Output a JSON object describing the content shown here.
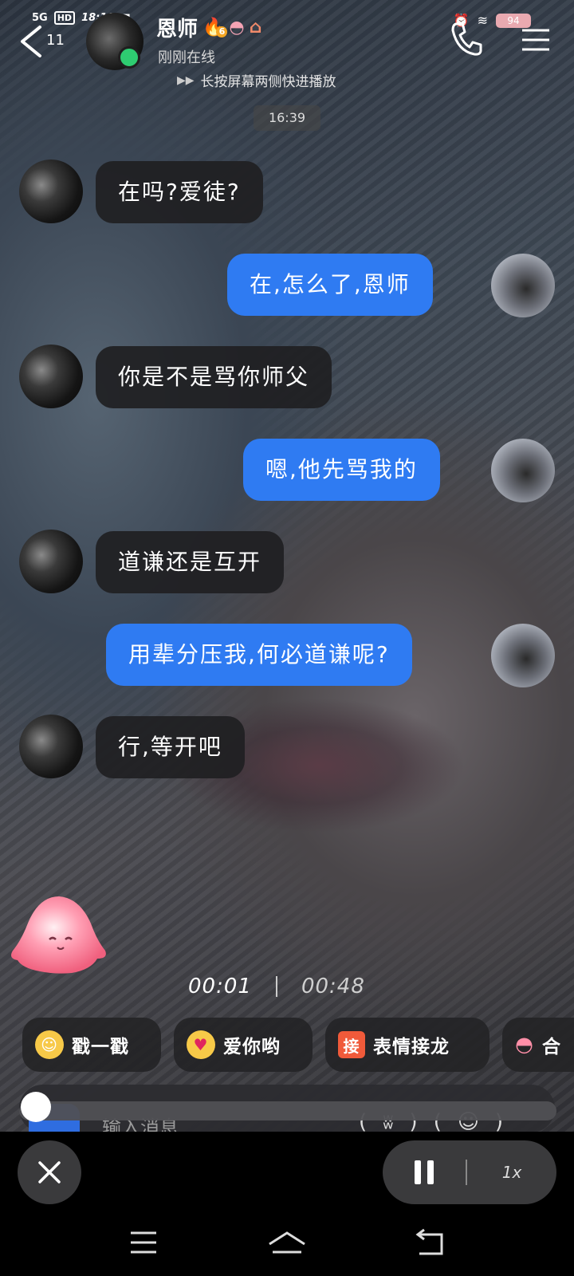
{
  "status_bar": {
    "signal": "5G",
    "hd": "HD",
    "time": "18:10",
    "battery": "94"
  },
  "header": {
    "unread_count": "11",
    "contact_name": "恩师",
    "fire_count": "6",
    "online_status": "刚刚在线",
    "hint": "长按屏幕两侧快进播放"
  },
  "chat": {
    "timestamp": "16:39",
    "messages": [
      {
        "side": "left",
        "text": "在吗?爱徒?"
      },
      {
        "side": "right",
        "text": "在,怎么了,恩师"
      },
      {
        "side": "left",
        "text": "你是不是骂你师父"
      },
      {
        "side": "right",
        "text": "嗯,他先骂我的"
      },
      {
        "side": "left",
        "text": "道谦还是互开"
      },
      {
        "side": "right",
        "text": "用辈分压我,何必道谦呢?"
      },
      {
        "side": "left",
        "text": "行,等开吧"
      }
    ]
  },
  "player": {
    "current_time": "00:01",
    "total_time": "00:48",
    "speed": "1x",
    "progress": 0.02
  },
  "quick_actions": [
    {
      "label": "戳一戳",
      "icon": "poke-icon"
    },
    {
      "label": "爱你哟",
      "icon": "heart-eyes-icon"
    },
    {
      "label": "表情接龙",
      "icon": "jie-icon",
      "icon_text": "接"
    },
    {
      "label": "合",
      "icon": "mascot-icon"
    }
  ],
  "input": {
    "placeholder": "输入消息"
  },
  "colors": {
    "sent_bubble": "#2f7bf2",
    "received_bubble": "#202022",
    "online_dot": "#2ecc71"
  }
}
